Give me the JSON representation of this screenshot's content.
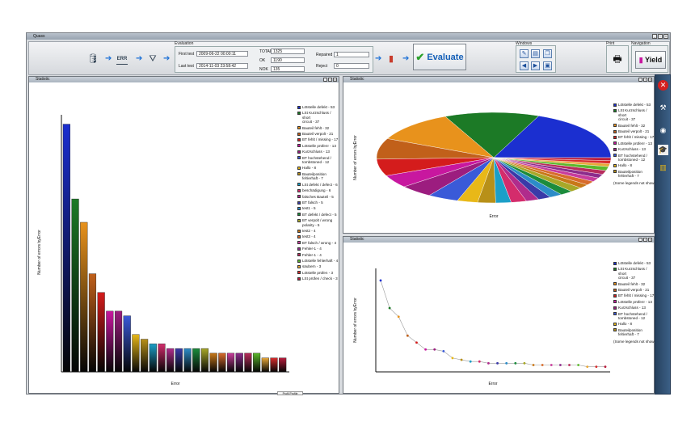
{
  "app": {
    "title": "Quass"
  },
  "toolbar": {
    "evaluation_label": "Evaluation",
    "first_test_label": "First test",
    "first_test_value": "2009-06-22   00:00:11",
    "last_test_label": "Last test",
    "last_test_value": "2014-11-03   23:58:42",
    "total_label": "TOTAL",
    "total_value": "1325",
    "ok_label": "OK",
    "ok_value": "1190",
    "nok_label": "NOK",
    "nok_value": "135",
    "repaired_label": "Repaired",
    "repaired_value": "1",
    "reject_label": "Reject",
    "reject_value": "0",
    "evaluate_label": "Evaluate",
    "windows_label": "Windows",
    "print_label": "Print",
    "navigation_label": "Navigation",
    "yield_label": "Yield",
    "db_icon": "database-icon",
    "err_icon_text": "ERR",
    "filter_icon": "funnel-icon"
  },
  "panels": {
    "bar": {
      "title": "Statistic"
    },
    "pie": {
      "title": "Statistic"
    },
    "line": {
      "title": "Statistic"
    }
  },
  "legend_note": "(Some legends not show",
  "bottom_tag": "Profil Profile",
  "colors": {
    "accent": "#1560b8",
    "ok_green": "#2aa02a"
  },
  "chart_data": [
    {
      "type": "bar",
      "title": "",
      "xlabel": "Error",
      "ylabel": "Number of errors byError",
      "ylim": [
        0,
        55
      ],
      "grid": false,
      "legend": "right",
      "categories": [
        "Lötstelle defekt",
        "LSt Kurzschluss / short circuit",
        "Bauteil fehlt",
        "Bauteil verpolt",
        "BT fehlt / missing",
        "Lötstelle prüfen!",
        "Kurzschluss",
        "BT hochstehend / tombstoned",
        "Hallo",
        "Bauteilposition fehlerhaft",
        "LSt defekt / defect",
        "beschädigung",
        "falsches Bauteil",
        "BT falsch",
        "test1",
        "BT defekt / defect",
        "BT verpolt / wrong polarity",
        "test2",
        "test3",
        "BT falsch / wrong",
        "Fehler-1",
        "Fehler-1",
        "Lötstelle fehlerhaft",
        "säubern",
        "Lötstelle prüfen",
        "LSt prüfen / check"
      ],
      "values": [
        53,
        37,
        32,
        21,
        17,
        13,
        13,
        12,
        8,
        7,
        6,
        6,
        5,
        5,
        5,
        5,
        5,
        4,
        4,
        4,
        4,
        4,
        4,
        3,
        3,
        3
      ],
      "colors": [
        "#1b2fd0",
        "#1c7a26",
        "#e8921c",
        "#c1601a",
        "#d41c1c",
        "#c8179f",
        "#9c1d7f",
        "#3a5ad8",
        "#e8b818",
        "#b89018",
        "#1c9fc8",
        "#d42c6c",
        "#b02c8c",
        "#3a3aa8",
        "#2c8cc8",
        "#1c8c3c",
        "#a8a828",
        "#c87818",
        "#d86c2c",
        "#c83c9c",
        "#8c2c8c",
        "#b82c5c",
        "#5cb82c",
        "#e8a838",
        "#d82c2c",
        "#b81c3c"
      ],
      "legend_entries": [
        "Lötstelle defekt - 53",
        "LSt Kurzschluss / short\ncircuit - 37",
        "Bauteil fehlt - 32",
        "Bauteil verpolt - 21",
        "BT fehlt / missing - 17",
        "Lötstelle prüfen! - 13",
        "Kurzschluss - 13",
        "BT hochstehend /\ntombstoned - 12",
        "Hallo - 8",
        "Bauteilposition\nfehlerhaft - 7",
        "LSt defekt / defect - 6",
        "beschädigung - 6",
        "falsches Bauteil - 5",
        "BT falsch - 5",
        "test1 - 5",
        "BT defekt / defect - 5",
        "BT verpolt / wrong\npolarity - 5",
        "test2 - 4",
        "test3 - 4",
        "BT falsch / wrong - 4",
        "Fehler-1 - 4",
        "Fehler-1 - 4",
        "Lötstelle fehlerhaft - 4",
        "säubern - 3",
        "Lötstelle prüfen - 3",
        "LSt prüfen / check - 3"
      ]
    },
    {
      "type": "pie",
      "title": "",
      "xlabel": "Error",
      "ylabel": "Number of errors byError",
      "legend": "right",
      "values": [
        53,
        37,
        32,
        21,
        17,
        13,
        13,
        12,
        8,
        7,
        6,
        6,
        5,
        5,
        5,
        5,
        5,
        4,
        4,
        4,
        4,
        4,
        4,
        3,
        3,
        3
      ],
      "colors": [
        "#1b2fd0",
        "#1c7a26",
        "#e8921c",
        "#c1601a",
        "#d41c1c",
        "#c8179f",
        "#9c1d7f",
        "#3a5ad8",
        "#e8b818",
        "#b89018",
        "#1c9fc8",
        "#d42c6c",
        "#b02c8c",
        "#3a3aa8",
        "#2c8cc8",
        "#1c8c3c",
        "#a8a828",
        "#c87818",
        "#d86c2c",
        "#c83c9c",
        "#8c2c8c",
        "#b82c5c",
        "#5cb82c",
        "#e8a838",
        "#d82c2c",
        "#b81c3c"
      ],
      "legend_entries": [
        "Lötstelle defekt - 53",
        "LSt Kurzschluss / short\ncircuit - 37",
        "Bauteil fehlt - 32",
        "Bauteil verpolt - 21",
        "BT fehlt / missing - 17",
        "Lötstelle prüfen! - 13",
        "Kurzschluss - 13",
        "BT hochstehend /\ntombstoned - 12",
        "Hallo - 8",
        "Bauteilposition\nfehlerhaft - 7"
      ]
    },
    {
      "type": "line",
      "title": "",
      "xlabel": "Error",
      "ylabel": "Number of errors byError",
      "ylim": [
        0,
        60
      ],
      "legend": "right",
      "values": [
        53,
        37,
        32,
        21,
        17,
        13,
        13,
        12,
        8,
        7,
        6,
        6,
        5,
        5,
        5,
        5,
        5,
        4,
        4,
        4,
        4,
        4,
        4,
        3,
        3,
        3
      ],
      "colors": [
        "#1b2fd0",
        "#1c7a26",
        "#e8921c",
        "#c1601a",
        "#d41c1c",
        "#c8179f",
        "#9c1d7f",
        "#3a5ad8",
        "#e8b818",
        "#b89018",
        "#1c9fc8",
        "#d42c6c",
        "#b02c8c",
        "#3a3aa8",
        "#2c8cc8",
        "#1c8c3c",
        "#a8a828",
        "#c87818",
        "#d86c2c",
        "#c83c9c",
        "#8c2c8c",
        "#b82c5c",
        "#5cb82c",
        "#e8a838",
        "#d82c2c",
        "#b81c3c"
      ],
      "legend_entries": [
        "Lötstelle defekt - 53",
        "LSt Kurzschluss / short\ncircuit - 37",
        "Bauteil fehlt - 32",
        "Bauteil verpolt - 21",
        "BT fehlt / missing - 17",
        "Lötstelle prüfen! - 13",
        "Kurzschluss - 13",
        "BT hochstehend /\ntombstoned - 12",
        "Hallo - 8",
        "Bauteilposition\nfehlerhaft - 7"
      ]
    }
  ]
}
